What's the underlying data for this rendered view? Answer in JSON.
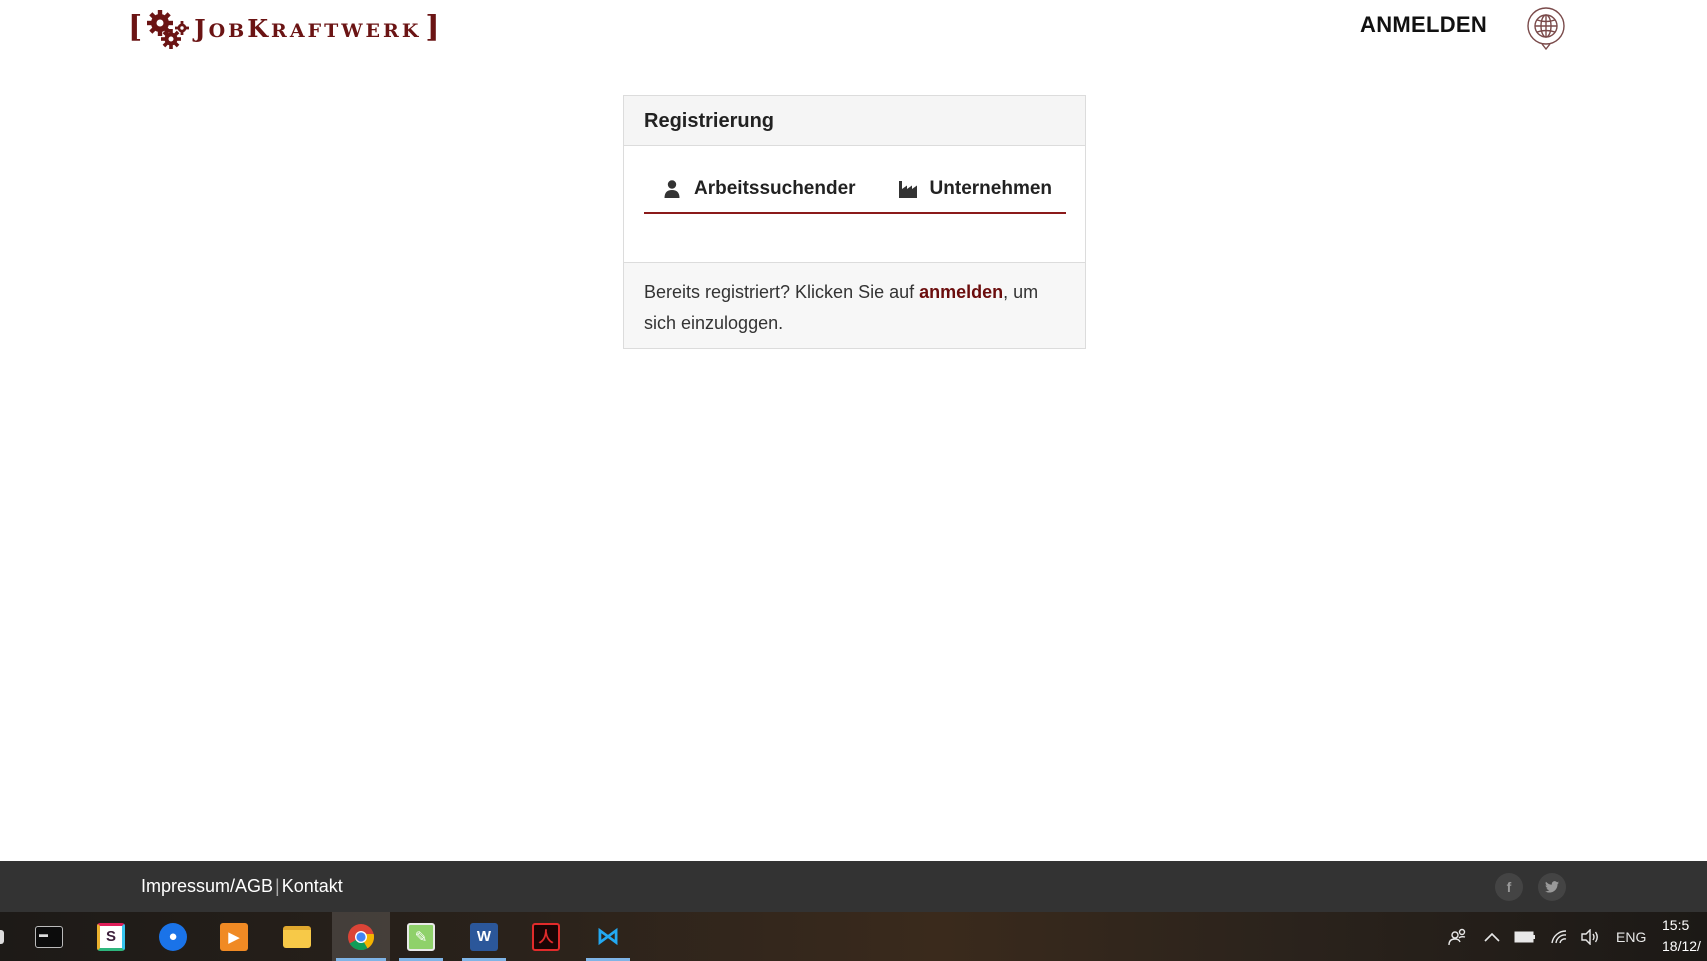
{
  "header": {
    "logo": {
      "open_bracket": "[",
      "first_letter": "J",
      "rest_1": "OB",
      "second_letter": "K",
      "rest_2": "RAFTWERK",
      "close_bracket": "]"
    },
    "login_label": "ANMELDEN",
    "globe_icon": "globe-chat-icon"
  },
  "card": {
    "title": "Registrierung",
    "tabs": [
      {
        "label": "Arbeitssuchender",
        "icon": "user-icon"
      },
      {
        "label": "Unternehmen",
        "icon": "factory-icon"
      }
    ],
    "footer_text_before": "Bereits registriert? Klicken Sie auf ",
    "footer_link": "anmelden",
    "footer_text_after": ", um sich einzuloggen."
  },
  "footer": {
    "links": [
      "Impressum/AGB",
      "Kontakt"
    ],
    "separator": "|",
    "social": [
      {
        "name": "facebook-icon",
        "glyph": "f"
      },
      {
        "name": "twitter-icon",
        "glyph": "t"
      }
    ]
  },
  "taskbar": {
    "apps": [
      {
        "name": "terminal"
      },
      {
        "name": "slack"
      },
      {
        "name": "maps"
      },
      {
        "name": "media-player"
      },
      {
        "name": "file-explorer"
      },
      {
        "name": "chrome",
        "active": true
      },
      {
        "name": "notepad-plus"
      },
      {
        "name": "word"
      },
      {
        "name": "acrobat"
      },
      {
        "name": "vscode"
      }
    ],
    "language": "ENG",
    "time": "15:5",
    "date": "18/12/"
  },
  "colors": {
    "brand": "#6b1414",
    "tab_underline": "#8b1a1a",
    "footer_bg": "#333333"
  }
}
